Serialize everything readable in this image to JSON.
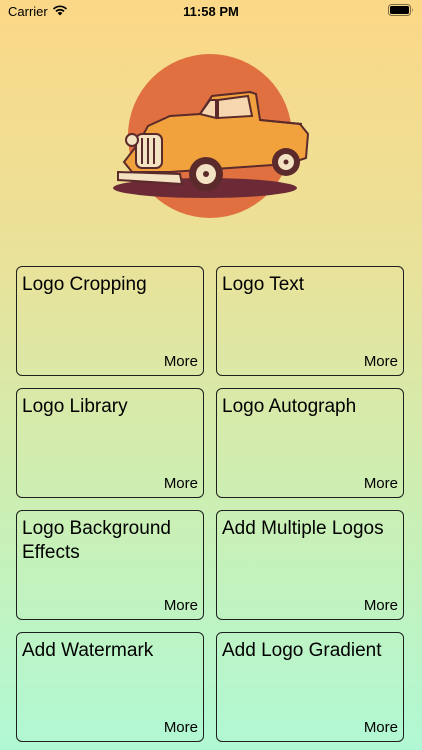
{
  "status_bar": {
    "carrier": "Carrier",
    "time": "11:58 PM"
  },
  "logo": {
    "icon": "vintage-pickup-truck-logo",
    "circle_color": "#e0703f",
    "truck_color": "#f2a23c"
  },
  "features": [
    {
      "title": "Logo Cropping",
      "more": "More"
    },
    {
      "title": "Logo Text",
      "more": "More"
    },
    {
      "title": "Logo Library",
      "more": "More"
    },
    {
      "title": "Logo Autograph",
      "more": "More"
    },
    {
      "title": "Logo Background Effects",
      "more": "More"
    },
    {
      "title": "Add Multiple Logos",
      "more": "More"
    },
    {
      "title": "Add Watermark",
      "more": "More"
    },
    {
      "title": "Add Logo Gradient",
      "more": "More"
    }
  ],
  "colors": {
    "gradient_top": "#fbd887",
    "gradient_bottom": "#b0f8d4",
    "card_border": "#1f1f1f"
  }
}
